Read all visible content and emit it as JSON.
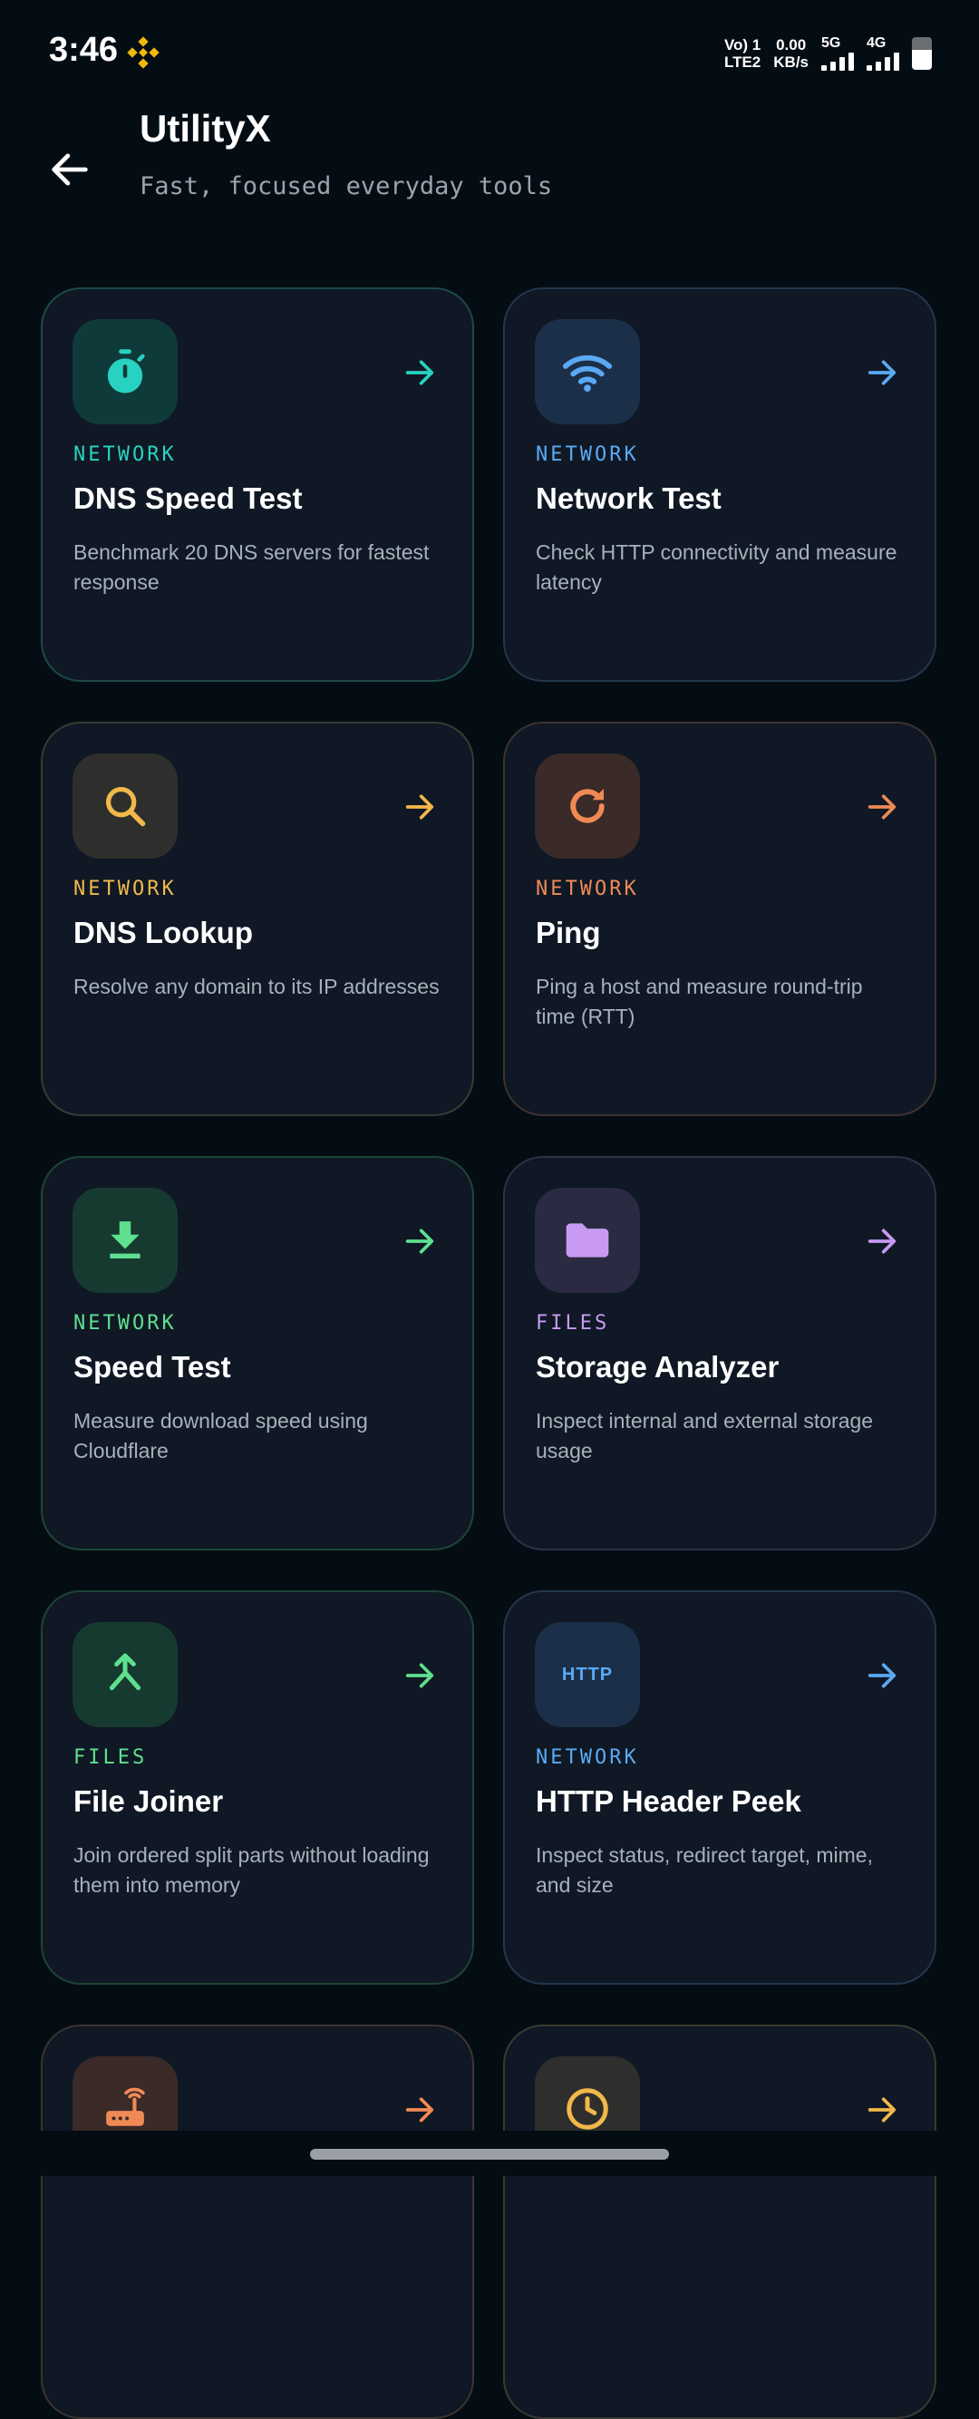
{
  "status_bar": {
    "time": "3:46",
    "volte_top": "Vo) 1",
    "volte_bottom": "LTE2",
    "speed_value": "0.00",
    "speed_unit": "KB/s",
    "sim1_type": "5G",
    "sim2_type": "4G",
    "battery_level": 0.6,
    "icons": [
      "binance-icon",
      "signal-icon",
      "battery-icon"
    ]
  },
  "header": {
    "title": "UtilityX",
    "subtitle": "Fast, focused everyday tools",
    "back_icon": "arrow-left-icon"
  },
  "cards": [
    {
      "category": "NETWORK",
      "title": "DNS Speed Test",
      "description": "Benchmark 20 DNS servers for fastest response",
      "icon": "stopwatch-icon",
      "accent": "#27d3c0"
    },
    {
      "category": "NETWORK",
      "title": "Network Test",
      "description": "Check HTTP connectivity and measure latency",
      "icon": "wifi-icon",
      "accent": "#5aa9f5"
    },
    {
      "category": "NETWORK",
      "title": "DNS Lookup",
      "description": "Resolve any domain to its IP addresses",
      "icon": "search-icon",
      "accent": "#f2b84a"
    },
    {
      "category": "NETWORK",
      "title": "Ping",
      "description": "Ping a host and measure round-trip time (RTT)",
      "icon": "refresh-icon",
      "accent": "#f08a55"
    },
    {
      "category": "NETWORK",
      "title": "Speed Test",
      "description": "Measure download speed using Cloudflare",
      "icon": "download-icon",
      "accent": "#5ee08f"
    },
    {
      "category": "FILES",
      "title": "Storage Analyzer",
      "description": "Inspect internal and external storage usage",
      "icon": "folder-icon",
      "accent": "#c89af4"
    },
    {
      "category": "FILES",
      "title": "File Joiner",
      "description": "Join ordered split parts without loading them into memory",
      "icon": "merge-icon",
      "accent": "#5ee08f"
    },
    {
      "category": "NETWORK",
      "title": "HTTP Header Peek",
      "description": "Inspect status, redirect target, mime, and size",
      "icon": "http-icon",
      "icon_text": "HTTP",
      "accent": "#5aa9f5"
    },
    {
      "icon": "router-icon",
      "accent": "#f08a55"
    },
    {
      "icon": "clock-icon",
      "accent": "#f2b84a"
    }
  ]
}
